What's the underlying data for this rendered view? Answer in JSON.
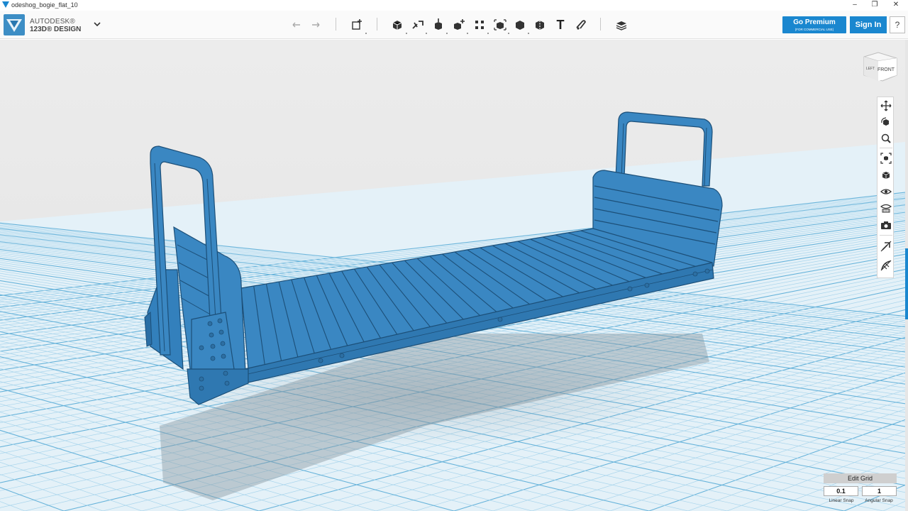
{
  "window": {
    "title": "odeshog_bogie_flat_10",
    "minimize_glyph": "–",
    "maximize_glyph": "❐",
    "close_glyph": "✕"
  },
  "brand": {
    "line1": "AUTODESK®",
    "line2": "123D® DESIGN"
  },
  "toolbar": {
    "tools": [
      {
        "name": "undo-icon"
      },
      {
        "name": "redo-icon"
      },
      {
        "name": "transform-icon"
      },
      {
        "name": "primitives-icon"
      },
      {
        "name": "sketch-icon"
      },
      {
        "name": "construct-icon"
      },
      {
        "name": "modify-icon"
      },
      {
        "name": "pattern-icon"
      },
      {
        "name": "group-icon"
      },
      {
        "name": "combine-icon"
      },
      {
        "name": "measure-icon"
      },
      {
        "name": "text-icon"
      },
      {
        "name": "snap-icon"
      },
      {
        "name": "materials-icon"
      }
    ],
    "text_tool_glyph": "T",
    "premium_label": "Go Premium",
    "premium_sublabel": "(FOR COMMERCIAL USE)",
    "signin_label": "Sign In",
    "help_label": "?"
  },
  "viewcube": {
    "front_label": "FRONT",
    "left_label": "LEFT"
  },
  "navbar": {
    "icons": [
      "pan-icon",
      "orbit-icon",
      "zoom-icon",
      "fit-icon",
      "view-icon",
      "visibility-icon",
      "materials-visibility-icon",
      "camera-icon",
      "hide-sketch-icon",
      "hide-mesh-icon"
    ]
  },
  "grid": {
    "edit_label": "Edit Grid",
    "linear_snap_value": "0.1",
    "angular_snap_value": "1",
    "linear_snap_label": "Linear Snap",
    "angular_snap_label": "Angular Snap"
  },
  "colors": {
    "model": "#3a87c2",
    "model_dark": "#1f5f92",
    "grid_minor": "#a9d5ec",
    "grid_major": "#67b3da",
    "accent": "#1a87cf"
  }
}
